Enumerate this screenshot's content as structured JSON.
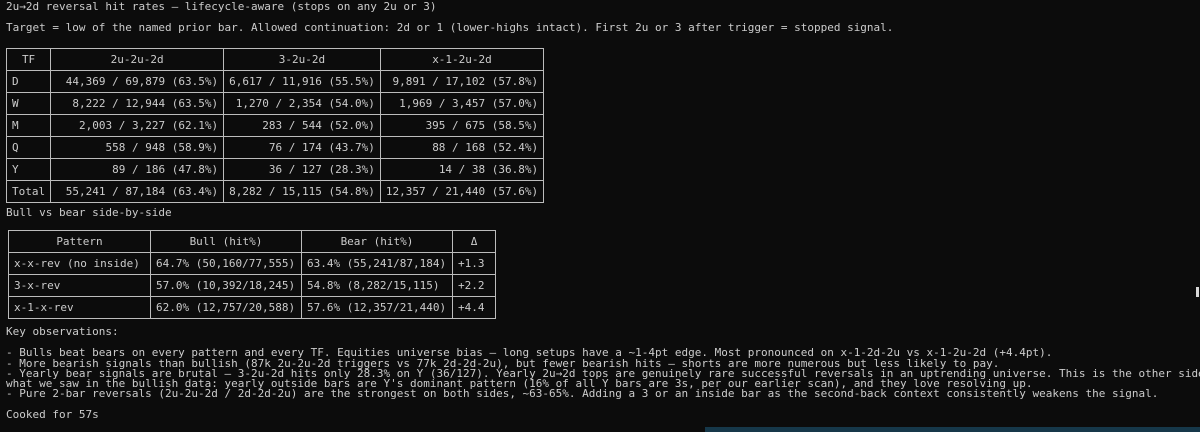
{
  "header": {
    "title": "2u→2d reversal hit rates — lifecycle-aware (stops on any 2u or 3)",
    "target_note": "Target = low of the named prior bar. Allowed continuation: 2d or 1 (lower-highs intact). First 2u or 3 after trigger = stopped signal."
  },
  "tf_table": {
    "headers": [
      "TF",
      "2u-2u-2d",
      "3-2u-2d",
      "x-1-2u-2d"
    ],
    "rows": [
      [
        "D",
        "44,369 / 69,879 (63.5%)",
        "6,617 / 11,916 (55.5%)",
        "9,891 / 17,102 (57.8%)"
      ],
      [
        "W",
        "8,222 / 12,944 (63.5%)",
        "1,270 / 2,354 (54.0%)",
        "1,969 / 3,457 (57.0%)"
      ],
      [
        "M",
        "2,003 / 3,227 (62.1%)",
        "283 / 544 (52.0%)",
        "395 / 675 (58.5%)"
      ],
      [
        "Q",
        "558 / 948 (58.9%)",
        "76 / 174 (43.7%)",
        "88 / 168 (52.4%)"
      ],
      [
        "Y",
        "89 / 186 (47.8%)",
        "36 / 127 (28.3%)",
        "14 / 38 (36.8%)"
      ],
      [
        "Total",
        "55,241 / 87,184 (63.4%)",
        "8,282 / 15,115 (54.8%)",
        "12,357 / 21,440 (57.6%)"
      ]
    ]
  },
  "section_heading": "Bull vs bear side-by-side",
  "bb_table": {
    "headers": [
      "Pattern",
      "Bull (hit%)",
      "Bear (hit%)",
      "Δ"
    ],
    "rows": [
      [
        "x-x-rev (no inside)",
        "64.7% (50,160/77,555)",
        "63.4% (55,241/87,184)",
        "+1.3"
      ],
      [
        "3-x-rev",
        "57.0% (10,392/18,245)",
        "54.8% (8,282/15,115)",
        "+2.2"
      ],
      [
        "x-1-x-rev",
        "62.0% (12,757/20,588)",
        "57.6% (12,357/21,440)",
        "+4.4"
      ]
    ]
  },
  "observations": {
    "heading": "Key observations:",
    "lines": [
      "- Bulls beat bears on every pattern and every TF. Equities universe bias — long setups have a ~1-4pt edge. Most pronounced on x-1-2d-2u vs x-1-2u-2d (+4.4pt).",
      "- More bearish signals than bullish (87k 2u-2u-2d triggers vs 77k 2d-2d-2u), but fewer bearish hits — shorts are more numerous but less likely to pay.",
      "- Yearly bear signals are brutal — 3-2u-2d hits only 28.3% on Y (36/127). Yearly 2u→2d tops are genuinely rare successful reversals in an uptrending universe. This is the other side of",
      "what we saw in the bullish data: yearly outside bars are Y's dominant pattern (16% of all Y bars are 3s, per our earlier scan), and they love resolving up.",
      "- Pure 2-bar reversals (2u-2u-2d / 2d-2d-2u) are the strongest on both sides, ~63-65%. Adding a 3 or an inside bar as the second-back context consistently weakens the signal."
    ]
  },
  "footer": {
    "status": "Cooked for 57s"
  }
}
